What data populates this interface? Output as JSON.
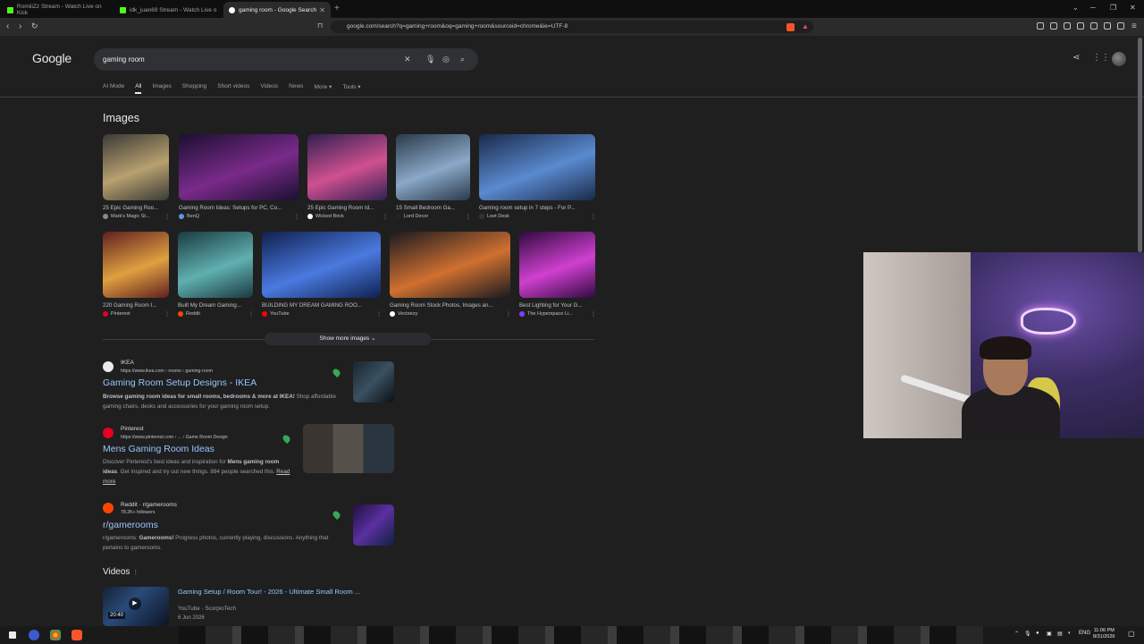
{
  "browser": {
    "tabs": [
      {
        "label": "RomiiiZz Stream - Watch Live on Kick",
        "color": "#53fc18"
      },
      {
        "label": "idk_juan69 Stream - Watch Live o",
        "color": "#53fc18"
      },
      {
        "label": "gaming room - Google Search",
        "color": "#ffffff"
      }
    ],
    "url": "google.com/search?q=gaming+room&oq=gaming+room&sourceid=chrome&ie=UTF-8"
  },
  "google": {
    "logo": "Google",
    "query": "gaming room",
    "tabs": [
      "AI Mode",
      "All",
      "Images",
      "Shopping",
      "Short videos",
      "Videos",
      "News",
      "More ▾",
      "Tools ▾"
    ],
    "images_heading": "Images",
    "images": [
      {
        "caption": "25 Epic Gaming Roo...",
        "source": "Mark's Magic St...",
        "c1": "#3a3a35",
        "c2": "#b8a070"
      },
      {
        "caption": "Gaming Room Ideas: Setups for PC, Co...",
        "source": "BenQ",
        "c1": "#1a1030",
        "c2": "#7a2a8a"
      },
      {
        "caption": "25 Epic Gaming Room Id...",
        "source": "Wicked Brick",
        "c1": "#302050",
        "c2": "#d05090"
      },
      {
        "caption": "15 Small Bedroom Ga...",
        "source": "Lord Decor",
        "c1": "#2a3a4a",
        "c2": "#8aa8c8"
      },
      {
        "caption": "Gaming room setup in 7 steps - For P...",
        "source": "Leet Desk",
        "c1": "#1a2a4a",
        "c2": "#5a8ad0"
      },
      {
        "caption": "220 Gaming Room I...",
        "source": "Pinterest",
        "c1": "#602020",
        "c2": "#e0a040"
      },
      {
        "caption": "Built My Dream Gaming...",
        "source": "Reddit",
        "c1": "#1a3a40",
        "c2": "#60b0b0"
      },
      {
        "caption": "BUILDING MY DREAM GAMING ROO...",
        "source": "YouTube",
        "c1": "#102050",
        "c2": "#4a7ae0"
      },
      {
        "caption": "Gaming Room Stock Photos, Images an...",
        "source": "Vecteezy",
        "c1": "#1a1a20",
        "c2": "#d07030"
      },
      {
        "caption": "Best Lighting for Your G...",
        "source": "The Hyperspace Li...",
        "c1": "#300a40",
        "c2": "#d040d0"
      }
    ],
    "show_more": "Show more images",
    "results": [
      {
        "site": "IKEA",
        "url": "https://www.ikea.com › rooms › gaming-room",
        "title": "Gaming Room Setup Designs - IKEA",
        "desc_html_1": "Browse gaming room ideas for small rooms, bedrooms & more at IKEA!",
        "desc_html_2": " Shop affordable gaming chairs, desks and accessories for your gaming room setup."
      },
      {
        "site": "Pinterest",
        "url": "https://www.pinterest.com › ... › Game Room Design",
        "title": "Mens Gaming Room Ideas",
        "desc_1": "Discover Pinterest's best ideas and inspiration for ",
        "desc_b": "Mens gaming room ideas",
        "desc_2": ". Get inspired and try out new things. 894 people searched this. ",
        "read_more": "Read more"
      },
      {
        "site": "Reddit · r/gamerooms",
        "followers": "78.2K+ followers",
        "title": "r/gamerooms",
        "desc_1": "r/gamerooms: ",
        "desc_b": "Gamerooms!",
        "desc_2": " Progress photos, currently playing, discussions. Anything that pertains to gamerooms."
      }
    ],
    "videos_heading": "Videos",
    "video": {
      "title": "Gaming Setup / Room Tour! - 2026 - Ultimate Small Room ...",
      "platform": "YouTube · ScorpioTech",
      "date": "6 Jun 2026",
      "duration": "20:40"
    }
  },
  "taskbar": {
    "lang": "ENG",
    "time": "11:06 PM",
    "date": "8/31/2026"
  }
}
